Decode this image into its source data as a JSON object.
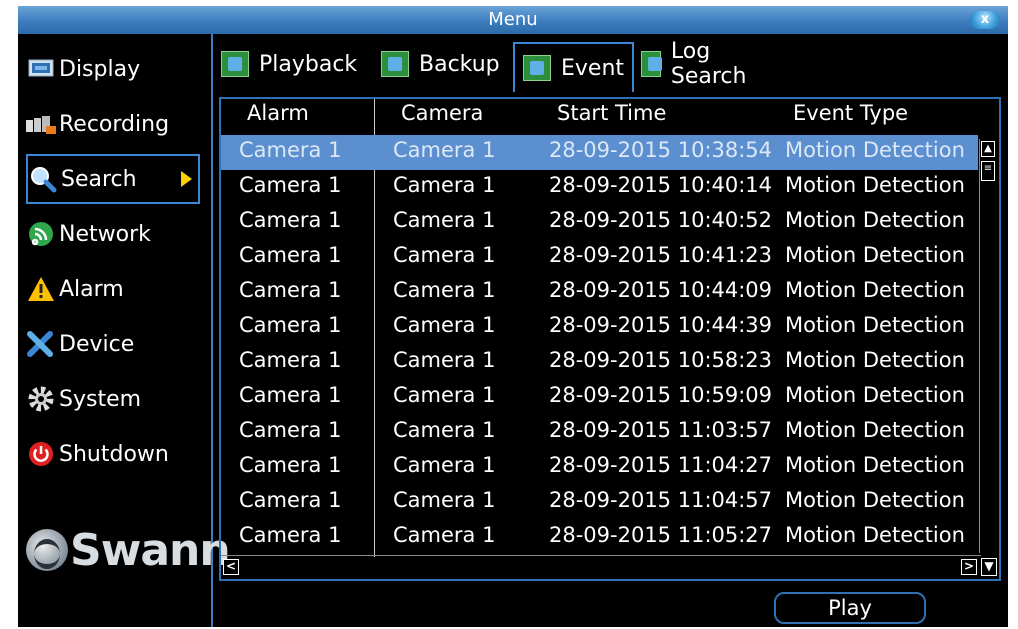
{
  "window": {
    "title": "Menu",
    "close_label": "x"
  },
  "sidebar": {
    "items": [
      {
        "label": "Display",
        "icon": "display-icon"
      },
      {
        "label": "Recording",
        "icon": "recording-icon"
      },
      {
        "label": "Search",
        "icon": "search-icon",
        "active": true
      },
      {
        "label": "Network",
        "icon": "network-icon"
      },
      {
        "label": "Alarm",
        "icon": "alarm-icon"
      },
      {
        "label": "Device",
        "icon": "device-icon"
      },
      {
        "label": "System",
        "icon": "system-icon"
      },
      {
        "label": "Shutdown",
        "icon": "shutdown-icon"
      }
    ],
    "logo": "Swann"
  },
  "tabs": [
    {
      "label": "Playback"
    },
    {
      "label": "Backup"
    },
    {
      "label": "Event",
      "active": true
    },
    {
      "label": "Log Search"
    }
  ],
  "table": {
    "columns": [
      "Alarm",
      "Camera",
      "Start Time",
      "Event Type"
    ],
    "rows": [
      [
        "Camera 1",
        "Camera 1",
        "28-09-2015 10:38:54",
        "Motion Detection"
      ],
      [
        "Camera 1",
        "Camera 1",
        "28-09-2015 10:40:14",
        "Motion Detection"
      ],
      [
        "Camera 1",
        "Camera 1",
        "28-09-2015 10:40:52",
        "Motion Detection"
      ],
      [
        "Camera 1",
        "Camera 1",
        "28-09-2015 10:41:23",
        "Motion Detection"
      ],
      [
        "Camera 1",
        "Camera 1",
        "28-09-2015 10:44:09",
        "Motion Detection"
      ],
      [
        "Camera 1",
        "Camera 1",
        "28-09-2015 10:44:39",
        "Motion Detection"
      ],
      [
        "Camera 1",
        "Camera 1",
        "28-09-2015 10:58:23",
        "Motion Detection"
      ],
      [
        "Camera 1",
        "Camera 1",
        "28-09-2015 10:59:09",
        "Motion Detection"
      ],
      [
        "Camera 1",
        "Camera 1",
        "28-09-2015 11:03:57",
        "Motion Detection"
      ],
      [
        "Camera 1",
        "Camera 1",
        "28-09-2015 11:04:27",
        "Motion Detection"
      ],
      [
        "Camera 1",
        "Camera 1",
        "28-09-2015 11:04:57",
        "Motion Detection"
      ],
      [
        "Camera 1",
        "Camera 1",
        "28-09-2015 11:05:27",
        "Motion Detection"
      ]
    ],
    "selected_row": 0
  },
  "play_button": "Play",
  "colors": {
    "accent": "#3c86d6",
    "selected_row": "#5b8fcf",
    "alert": "#ffd000"
  }
}
